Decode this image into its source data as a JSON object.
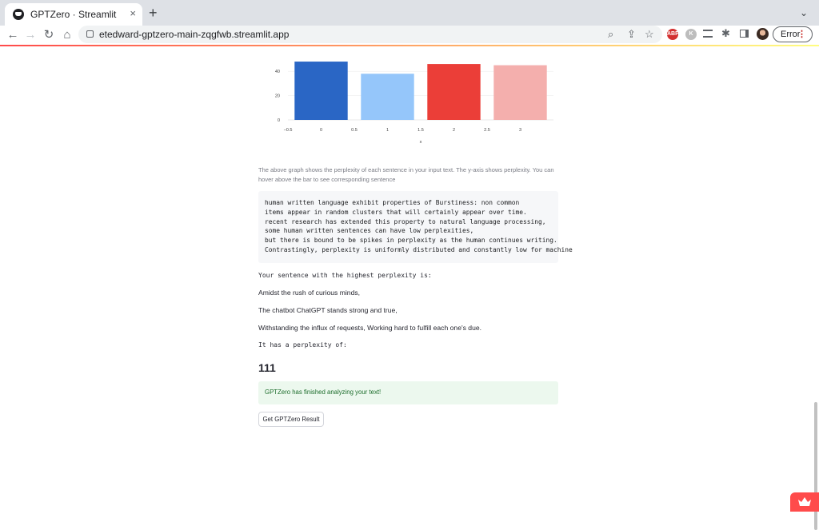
{
  "browser": {
    "tab_title": "GPTZero · Streamlit",
    "tab_close": "×",
    "new_tab": "+",
    "tab_menu": "⌄",
    "url": "etedward-gptzero-main-zqgfwb.streamlit.app",
    "nav": {
      "back": "←",
      "forward": "→",
      "reload": "↻",
      "home": "⌂"
    },
    "omnibox_icons": {
      "zoom": "⌕",
      "share": "⇪",
      "bookmark": "☆"
    },
    "extensions": [
      {
        "name": "adblock-icon",
        "label": "ABP",
        "color": "#d32f2f"
      },
      {
        "name": "k-extension-icon",
        "label": "K",
        "color": "#bdbdbd"
      }
    ],
    "error_label": "Error",
    "error_menu": "⋮"
  },
  "chart_data": {
    "type": "bar",
    "x": [
      0,
      1,
      2,
      3
    ],
    "values": [
      48,
      38,
      46,
      45
    ],
    "colors": [
      "#2a66c5",
      "#95c6fa",
      "#eb3e38",
      "#f4afad"
    ],
    "xlabel": "x",
    "xticks": [
      "−0.5",
      "0",
      "0.5",
      "1",
      "1.5",
      "2",
      "2.5",
      "3"
    ],
    "yticks": [
      "0",
      "20",
      "40"
    ],
    "xlim": [
      -0.5,
      3.5
    ],
    "ylim": [
      0,
      50
    ],
    "grid": true
  },
  "main": {
    "caption": "The above graph shows the perplexity of each sentence in your input text. The y-axis shows perplexity. You can hover above the bar to see corresponding sentence",
    "code_lines": [
      "human written language exhibit properties of Burstiness: non common",
      "items appear in random clusters that will certainly appear over time.",
      "recent research has extended this property to natural language processing,",
      "some human written sentences can have low perplexities,",
      "but there is bound to be spikes in perplexity as the human continues writing.",
      "Contrastingly, perplexity is uniformly distributed and constantly low for machine"
    ],
    "highest_label": "Your sentence with the highest perplexity is:",
    "sentence_lines": [
      "Amidst the rush of curious minds,",
      "The chatbot ChatGPT stands strong and true,",
      "Withstanding the influx of requests, Working hard to fulfill each one's due."
    ],
    "perplexity_label": "It has a perplexity of:",
    "perplexity_value": "111",
    "success_message": "GPTZero has finished analyzing your text!",
    "result_button": "Get GPTZero Result"
  }
}
